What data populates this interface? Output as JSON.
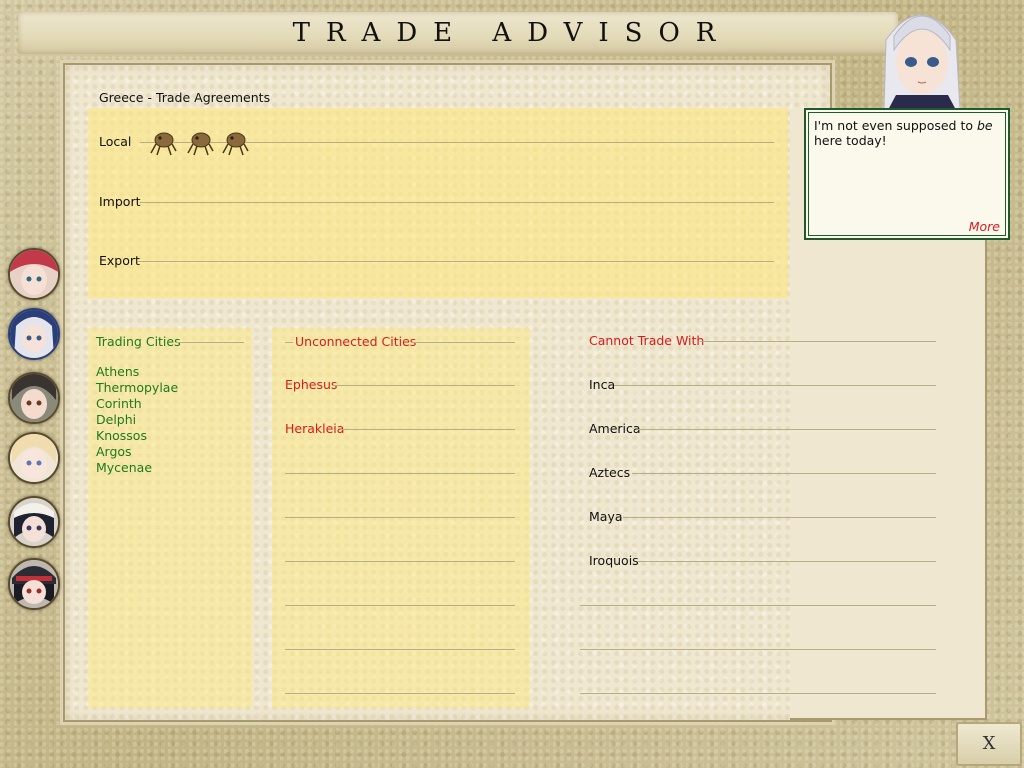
{
  "title": "TRADE ADVISOR",
  "agreements": {
    "heading": "Greece - Trade Agreements",
    "rows": [
      "Local",
      "Import",
      "Export"
    ]
  },
  "trading_cities": {
    "title": "Trading Cities",
    "items": [
      "Athens",
      "Thermopylae",
      "Corinth",
      "Delphi",
      "Knossos",
      "Argos",
      "Mycenae"
    ]
  },
  "unconnected_cities": {
    "title": "Unconnected Cities",
    "items": [
      "Ephesus",
      "Herakleia"
    ]
  },
  "cannot_trade": {
    "title": "Cannot Trade With",
    "items": [
      "Inca",
      "America",
      "Aztecs",
      "Maya",
      "Iroquois"
    ]
  },
  "speech": {
    "text_before": "I'm not even supposed to ",
    "text_em": "be",
    "text_after": " here today!",
    "more": "More"
  },
  "close_label": "X",
  "icons": {
    "local_resource": "crab-resource-icon",
    "advisor": "advisor-portrait"
  },
  "colors": {
    "highlight": "#ffe878",
    "green_text": "#1e7a1e",
    "red_text": "#d81b1b",
    "speech_border": "#1f5a2c"
  }
}
